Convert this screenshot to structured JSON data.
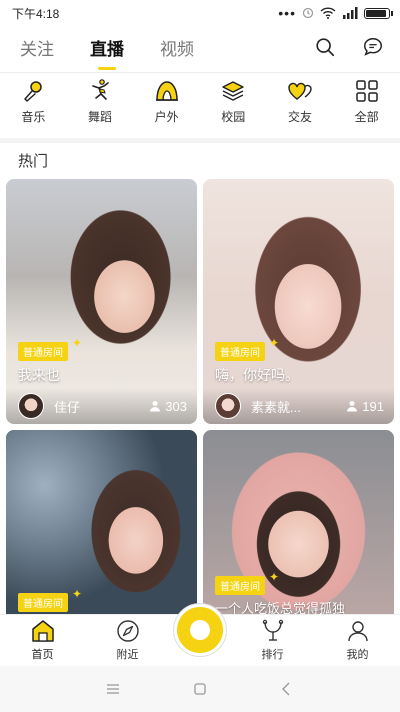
{
  "status_bar": {
    "time": "下午4:18",
    "icons": [
      "dots-icon",
      "alarm-icon",
      "wifi-icon",
      "signal-icon",
      "battery-icon"
    ],
    "battery_level": 0.85
  },
  "top_tabs": [
    {
      "label": "关注",
      "active": false
    },
    {
      "label": "直播",
      "active": true
    },
    {
      "label": "视频",
      "active": false
    }
  ],
  "top_icons": [
    "search-icon",
    "message-icon"
  ],
  "categories": [
    {
      "label": "音乐",
      "icon": "microphone-icon"
    },
    {
      "label": "舞蹈",
      "icon": "dancer-icon"
    },
    {
      "label": "户外",
      "icon": "tent-icon"
    },
    {
      "label": "校园",
      "icon": "books-icon"
    },
    {
      "label": "交友",
      "icon": "hearts-icon"
    },
    {
      "label": "全部",
      "icon": "grid-icon"
    }
  ],
  "section_title": "热门",
  "cards": [
    {
      "badge": "普通房间",
      "title": "我来也",
      "username": "佳仔",
      "viewers": "303"
    },
    {
      "badge": "普通房间",
      "title": "嗨，你好吗。",
      "username": "素素就...",
      "viewers": "191"
    },
    {
      "badge": "普通房间",
      "title": "",
      "username": "",
      "viewers": ""
    },
    {
      "badge": "普通房间",
      "title": "一个人吃饭总觉得孤独",
      "username": "",
      "viewers": ""
    }
  ],
  "bottom_nav": [
    {
      "label": "首页",
      "icon": "home-icon",
      "active": true
    },
    {
      "label": "附近",
      "icon": "compass-icon",
      "active": false
    },
    {
      "label": "排行",
      "icon": "trophy-icon",
      "active": false
    },
    {
      "label": "我的",
      "icon": "person-icon",
      "active": false
    }
  ],
  "colors": {
    "accent": "#f5d313",
    "text": "#222222",
    "muted": "#777777"
  }
}
